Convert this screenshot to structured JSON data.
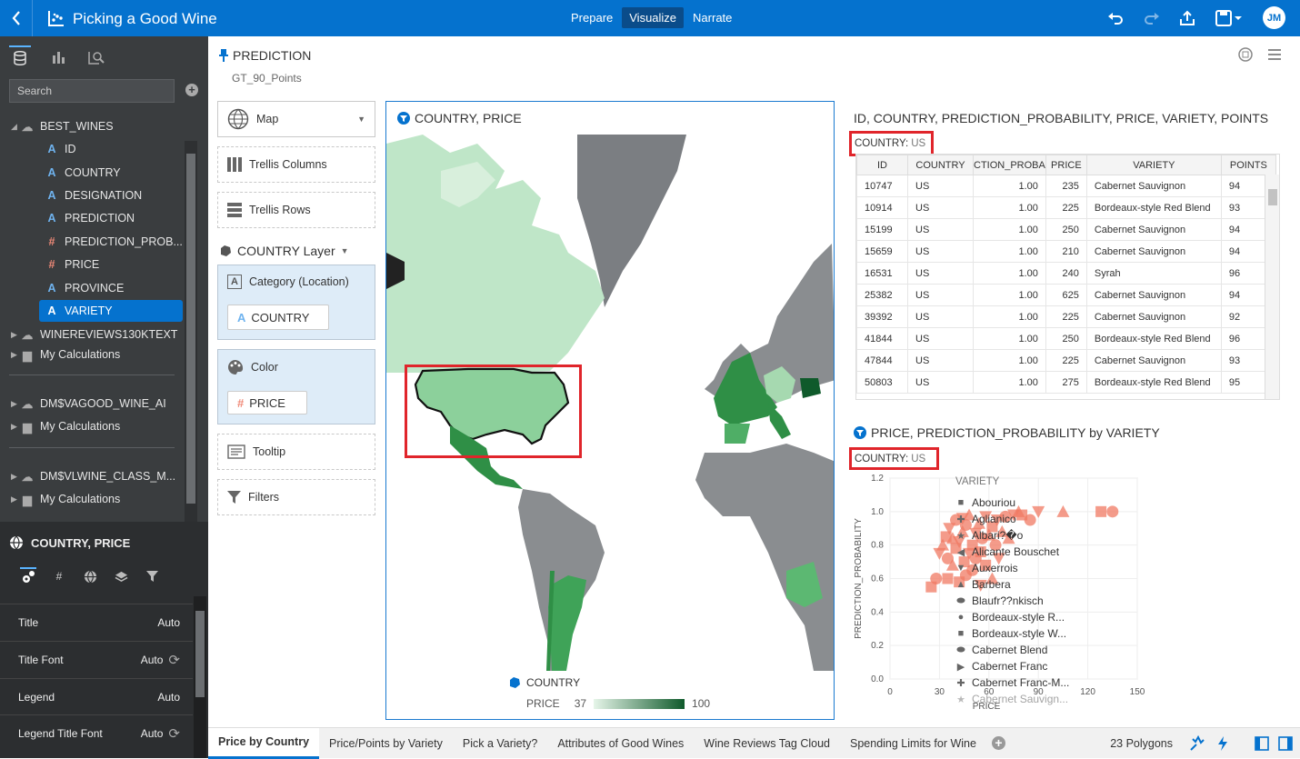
{
  "app": {
    "title": "Picking a Good Wine",
    "tabs": [
      "Prepare",
      "Visualize",
      "Narrate"
    ],
    "active_tab": "Visualize",
    "user_initials": "JM"
  },
  "left": {
    "search_placeholder": "Search",
    "tree": [
      {
        "label": "BEST_WINES",
        "kind": "db",
        "level": 0
      },
      {
        "label": "ID",
        "kind": "A",
        "level": 1
      },
      {
        "label": "COUNTRY",
        "kind": "A",
        "level": 1
      },
      {
        "label": "DESIGNATION",
        "kind": "A",
        "level": 1
      },
      {
        "label": "PREDICTION",
        "kind": "A",
        "level": 1
      },
      {
        "label": "PREDICTION_PROB...",
        "kind": "#",
        "level": 1
      },
      {
        "label": "PRICE",
        "kind": "#",
        "level": 1
      },
      {
        "label": "PROVINCE",
        "kind": "A",
        "level": 1
      },
      {
        "label": "VARIETY",
        "kind": "A",
        "level": 1
      },
      {
        "label": "WINEREVIEWS130KTEXT",
        "kind": "db",
        "level": 0
      },
      {
        "label": "My Calculations",
        "kind": "folder",
        "level": 0
      },
      {
        "label": "DM$VAGOOD_WINE_AI",
        "kind": "db",
        "level": 0
      },
      {
        "label": "My Calculations",
        "kind": "folder",
        "level": 0
      },
      {
        "label": "DM$VLWINE_CLASS_M...",
        "kind": "db",
        "level": 0
      },
      {
        "label": "My Calculations",
        "kind": "folder",
        "level": 0
      }
    ]
  },
  "props": {
    "title": "COUNTRY, PRICE",
    "rows": [
      {
        "label": "Title",
        "value": "Auto"
      },
      {
        "label": "Title Font",
        "value": "Auto"
      },
      {
        "label": "Legend",
        "value": "Auto"
      },
      {
        "label": "Legend Title Font",
        "value": "Auto"
      }
    ]
  },
  "canvas": {
    "pred_title": "PREDICTION",
    "pred_sub": "GT_90_Points",
    "viz_type": "Map",
    "trellis_columns": "Trellis Columns",
    "trellis_rows": "Trellis Rows",
    "layer": "COUNTRY Layer",
    "category_label": "Category (Location)",
    "category_value": "COUNTRY",
    "color_label": "Color",
    "color_value": "PRICE",
    "tooltip": "Tooltip",
    "filters": "Filters"
  },
  "map": {
    "title": "COUNTRY, PRICE",
    "legend_layer": "COUNTRY",
    "legend_measure": "PRICE",
    "legend_min": "37",
    "legend_max": "100"
  },
  "table": {
    "title": "ID, COUNTRY, PREDICTION_PROBABILITY, PRICE, VARIETY, POINTS",
    "filter_label": "COUNTRY:",
    "filter_value": "US",
    "columns": [
      "ID",
      "COUNTRY",
      "PREDICTION_PROBABILITY",
      "PRICE",
      "VARIETY",
      "POINTS"
    ],
    "rows": [
      [
        "10747",
        "US",
        "1.00",
        "235",
        "Cabernet Sauvignon",
        "94"
      ],
      [
        "10914",
        "US",
        "1.00",
        "225",
        "Bordeaux-style Red Blend",
        "93"
      ],
      [
        "15199",
        "US",
        "1.00",
        "250",
        "Cabernet Sauvignon",
        "94"
      ],
      [
        "15659",
        "US",
        "1.00",
        "210",
        "Cabernet Sauvignon",
        "94"
      ],
      [
        "16531",
        "US",
        "1.00",
        "240",
        "Syrah",
        "96"
      ],
      [
        "25382",
        "US",
        "1.00",
        "625",
        "Cabernet Sauvignon",
        "94"
      ],
      [
        "39392",
        "US",
        "1.00",
        "225",
        "Cabernet Sauvignon",
        "92"
      ],
      [
        "41844",
        "US",
        "1.00",
        "250",
        "Bordeaux-style Red Blend",
        "96"
      ],
      [
        "47844",
        "US",
        "1.00",
        "225",
        "Cabernet Sauvignon",
        "93"
      ],
      [
        "50803",
        "US",
        "1.00",
        "275",
        "Bordeaux-style Red Blend",
        "95"
      ]
    ]
  },
  "scatter": {
    "title": "PRICE, PREDICTION_PROBABILITY by VARIETY",
    "filter_label": "COUNTRY:",
    "filter_value": "US",
    "legend_title": "VARIETY",
    "legend": [
      {
        "name": "Abouriou",
        "sym": "■"
      },
      {
        "name": "Aglianico",
        "sym": "✚"
      },
      {
        "name": "Albari?�o",
        "sym": "★"
      },
      {
        "name": "Alicante Bouschet",
        "sym": "◀"
      },
      {
        "name": "Auxerrois",
        "sym": "▼"
      },
      {
        "name": "Barbera",
        "sym": "▲"
      },
      {
        "name": "Blaufr??nkisch",
        "sym": "⬬"
      },
      {
        "name": "Bordeaux-style R...",
        "sym": "●"
      },
      {
        "name": "Bordeaux-style W...",
        "sym": "■"
      },
      {
        "name": "Cabernet Blend",
        "sym": "⬬"
      },
      {
        "name": "Cabernet Franc",
        "sym": "▶"
      },
      {
        "name": "Cabernet Franc-M...",
        "sym": "✚"
      },
      {
        "name": "Cabernet Sauvign...",
        "sym": "★"
      }
    ]
  },
  "chart_data": {
    "type": "scatter",
    "title": "PRICE, PREDICTION_PROBABILITY by VARIETY",
    "xlabel": "PRICE",
    "ylabel": "PREDICTION_PROBABILITY",
    "xlim": [
      0,
      150
    ],
    "ylim": [
      0,
      1.2
    ],
    "xticks": [
      0,
      30,
      60,
      90,
      120,
      150
    ],
    "yticks": [
      0.0,
      0.2,
      0.4,
      0.6,
      0.8,
      1.0,
      1.2
    ],
    "color": "#f07a63",
    "points": [
      [
        25,
        0.55
      ],
      [
        28,
        0.6
      ],
      [
        30,
        0.75
      ],
      [
        32,
        0.8
      ],
      [
        34,
        0.85
      ],
      [
        35,
        0.72
      ],
      [
        36,
        0.9
      ],
      [
        38,
        0.68
      ],
      [
        40,
        0.78
      ],
      [
        40,
        0.95
      ],
      [
        42,
        0.82
      ],
      [
        44,
        0.88
      ],
      [
        45,
        0.7
      ],
      [
        46,
        0.92
      ],
      [
        48,
        0.75
      ],
      [
        48,
        0.98
      ],
      [
        50,
        0.8
      ],
      [
        50,
        0.65
      ],
      [
        52,
        0.87
      ],
      [
        54,
        0.93
      ],
      [
        55,
        0.76
      ],
      [
        56,
        0.84
      ],
      [
        58,
        0.97
      ],
      [
        60,
        0.86
      ],
      [
        62,
        0.91
      ],
      [
        64,
        0.8
      ],
      [
        65,
        0.95
      ],
      [
        68,
        0.88
      ],
      [
        42,
        0.58
      ],
      [
        46,
        0.62
      ],
      [
        55,
        0.56
      ],
      [
        62,
        0.6
      ],
      [
        35,
        0.6
      ],
      [
        70,
        0.97
      ],
      [
        75,
        0.98
      ],
      [
        78,
        1.0
      ],
      [
        80,
        0.98
      ],
      [
        85,
        0.95
      ],
      [
        90,
        1.0
      ],
      [
        105,
        1.0
      ],
      [
        128,
        1.0
      ],
      [
        135,
        1.0
      ],
      [
        66,
        0.72
      ],
      [
        72,
        0.84
      ],
      [
        58,
        0.68
      ],
      [
        52,
        0.72
      ],
      [
        44,
        0.96
      ],
      [
        38,
        0.84
      ]
    ]
  },
  "status": {
    "tabs": [
      "Price by Country",
      "Price/Points by Variety",
      "Pick a Variety?",
      "Attributes of Good Wines",
      "Wine Reviews Tag Cloud",
      "Spending Limits for Wine"
    ],
    "polygons": "23 Polygons"
  }
}
